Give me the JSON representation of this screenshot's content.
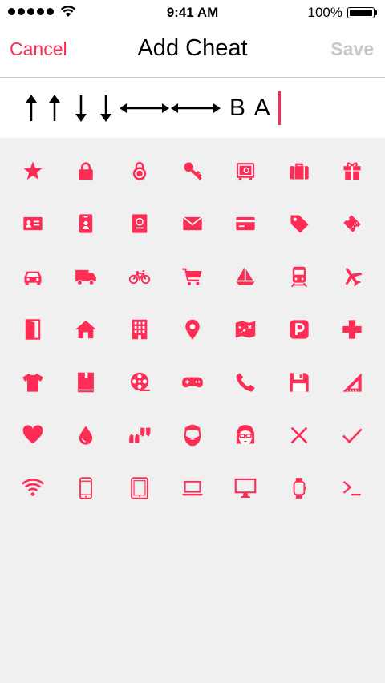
{
  "status_bar": {
    "time": "9:41 AM",
    "battery": "100%"
  },
  "nav": {
    "cancel_label": "Cancel",
    "title": "Add Cheat",
    "save_label": "Save"
  },
  "cheat": {
    "arrows": [
      "up",
      "up",
      "down",
      "down",
      "left",
      "right",
      "left",
      "right"
    ],
    "letters": "B A"
  },
  "accent_color": "#ff2d55",
  "icons": [
    "star-icon",
    "lock-icon",
    "padlock-icon",
    "key-icon",
    "safe-icon",
    "briefcase-icon",
    "gift-icon",
    "id-card-icon",
    "badge-icon",
    "passport-icon",
    "mail-icon",
    "credit-card-icon",
    "tag-icon",
    "ticket-icon",
    "car-icon",
    "truck-icon",
    "bicycle-icon",
    "shopping-cart-icon",
    "sailboat-icon",
    "train-icon",
    "airplane-icon",
    "door-icon",
    "house-icon",
    "building-icon",
    "map-pin-icon",
    "treasure-map-icon",
    "parking-icon",
    "medical-cross-icon",
    "t-shirt-icon",
    "book-icon",
    "film-reel-icon",
    "gamepad-icon",
    "phone-icon",
    "floppy-disk-icon",
    "set-square-icon",
    "heart-icon",
    "drop-icon",
    "quote-icon",
    "bearded-man-icon",
    "woman-with-glasses-icon",
    "x-mark-icon",
    "check-mark-icon",
    "wifi-icon",
    "smartphone-icon",
    "tablet-icon",
    "laptop-icon",
    "monitor-icon",
    "watch-icon",
    "terminal-icon"
  ]
}
